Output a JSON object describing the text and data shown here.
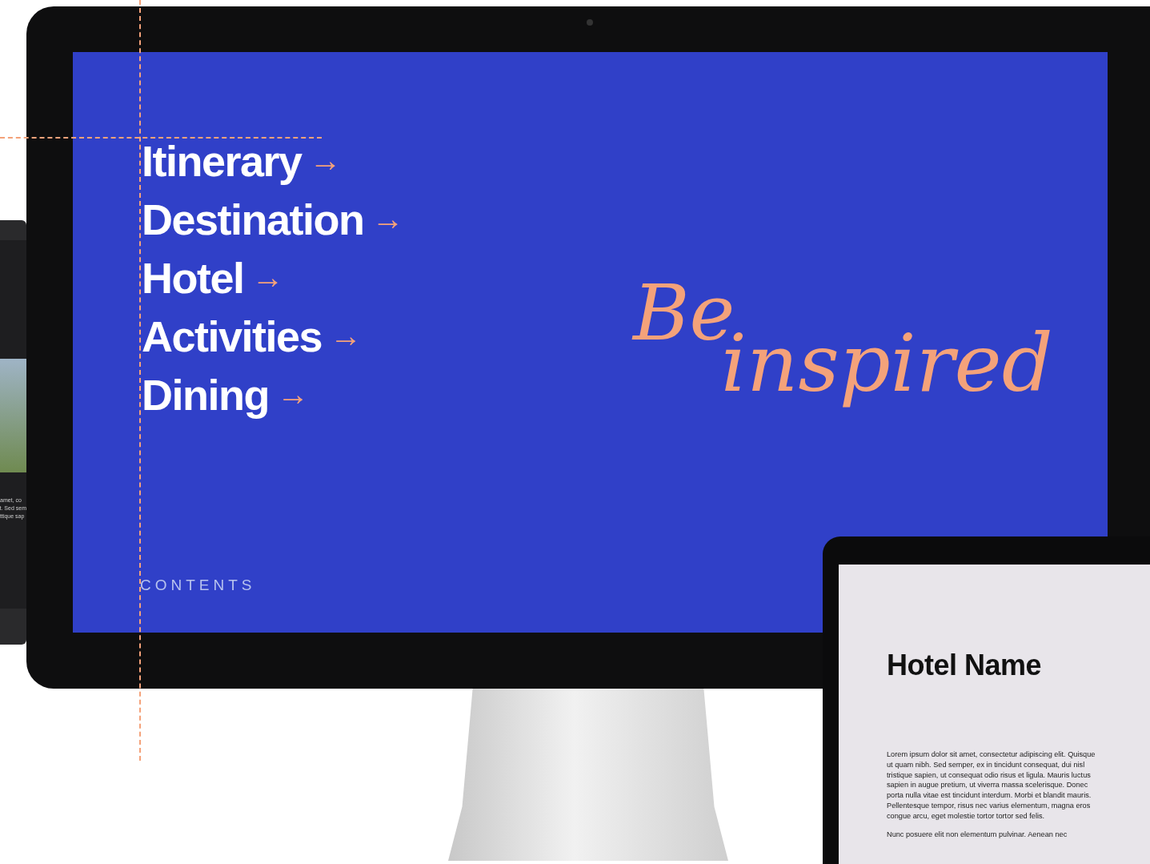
{
  "laptop": {
    "text_lines": [
      "amet, co",
      "t. Sed sem",
      "ttique sap"
    ]
  },
  "monitor": {
    "menu": [
      {
        "label": "Itinerary",
        "arrow": "→"
      },
      {
        "label": "Destination",
        "arrow": "→"
      },
      {
        "label": "Hotel",
        "arrow": "→"
      },
      {
        "label": "Activities",
        "arrow": "→"
      },
      {
        "label": "Dining",
        "arrow": "→"
      }
    ],
    "section_label": "CONTENTS",
    "tagline": [
      "Be",
      "inspired"
    ]
  },
  "tablet": {
    "title": "Hotel Name",
    "paragraphs": [
      "Lorem ipsum dolor sit amet, consectetur adipiscing elit. Quisque ut quam nibh. Sed semper, ex in tincidunt consequat, dui nisl tristique sapien, ut consequat odio risus et ligula. Mauris luctus sapien in augue pretium, ut viverra massa scelerisque. Donec porta nulla vitae est tincidunt interdum. Morbi et blandit mauris. Pellentesque tempor, risus nec varius elementum, magna eros congue arcu, eget molestie tortor tortor sed felis.",
      "Nunc posuere elit non elementum pulvinar. Aenean nec"
    ]
  }
}
